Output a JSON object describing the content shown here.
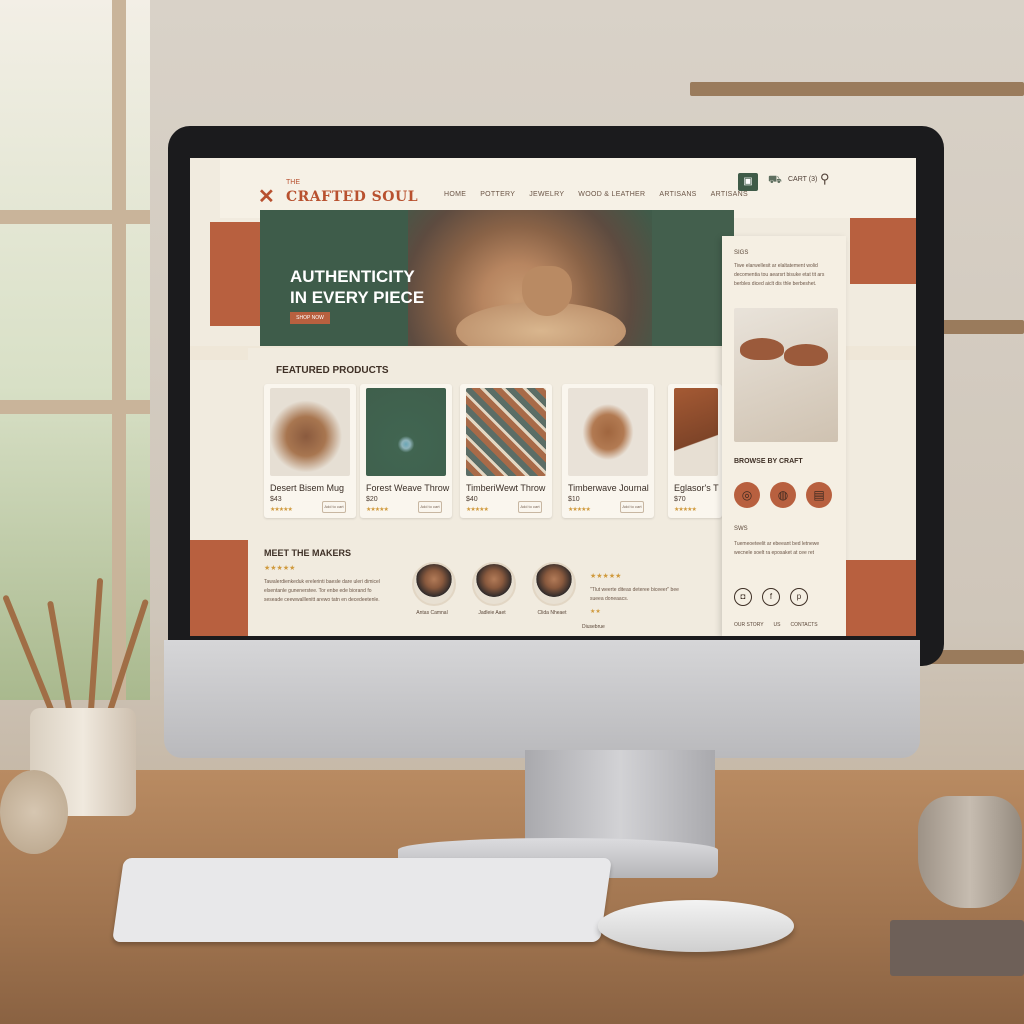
{
  "site": {
    "logo_prefix": "THE",
    "logo_text": "CRAFTED SOUL"
  },
  "nav": {
    "items": [
      "HOME",
      "POTTERY",
      "JEWELRY",
      "WOOD & LEATHER",
      "ARTISANS",
      "ARTISANS"
    ],
    "cart_label": "CART (3)"
  },
  "hero": {
    "title": "AUTHENTICITY IN EVERY PIECE",
    "button_label": "SHOP NOW"
  },
  "featured": {
    "title": "FEATURED PRODUCTS",
    "add_label": "Add to cart",
    "products": [
      {
        "name": "Desert Bisem Mug",
        "price": "$43",
        "stars": "★★★★★"
      },
      {
        "name": "Forest Weave Throw",
        "price": "$20",
        "stars": "★★★★★"
      },
      {
        "name": "TimberiWewt Throw",
        "price": "$40",
        "stars": "★★★★★"
      },
      {
        "name": "Timberwave Journal",
        "price": "$10",
        "stars": "★★★★★"
      },
      {
        "name": "Eglasor's T",
        "price": "$70",
        "stars": "★★★★★"
      }
    ]
  },
  "sidebar": {
    "head": "SIGS",
    "text": "Tiwe elarwellesit ar elaltatement wolid decomentia tou aearsrt bisuke etat tit ars berbles diced aiclt dis thle berbeshet.",
    "browse_title": "BROWSE BY CRAFT",
    "crafts": [
      "ring-icon",
      "pot-icon",
      "spool-icon"
    ],
    "head2": "SWS",
    "text2": "Tuemeoeteelit ar ebeeant bed letnewe wecnele soelt ra eposaket at cee ret",
    "social": [
      "instagram-icon",
      "facebook-icon",
      "pinterest-icon"
    ],
    "links": [
      "OUR STORY",
      "US",
      "CONTACTS"
    ]
  },
  "makers": {
    "title": "MEET THE MAKERS",
    "stars": "★★★★★",
    "text": "Tawalerdienkeduk erelerinti baesle dare uleri dimicel elsentanle gunenerstee. Tor enbe ede biorand fo seseade ceewwalllenitt arewo tatn en decedeetenle.",
    "artisans": [
      "Antas Camnal",
      "Jadleie Aaet",
      "Clida Nheaet"
    ],
    "quote_stars": "★★★★★",
    "quote_text": "\"Tlut weerte diteas deteree biceeer\" bee sueea doneaacs.",
    "quote_stars2": "★★",
    "quote_name": "Diusebrue"
  },
  "colors": {
    "terracotta": "#b8603f",
    "forest": "#3e5c4a",
    "cream": "#f1ebdf",
    "star": "#d09a3e"
  }
}
